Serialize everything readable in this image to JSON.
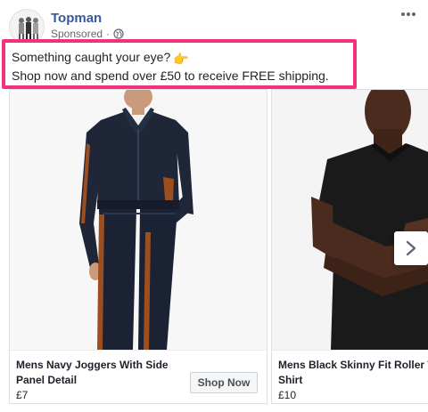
{
  "header": {
    "page_name": "Topman",
    "sponsored_label": "Sponsored",
    "separator": "·",
    "privacy_icon": "globe-icon",
    "more_icon": "more-dots-icon"
  },
  "caption": {
    "line1": "Something caught your eye?",
    "line1_emoji": "👉",
    "line2": "Shop now and spend over £50 to receive FREE shipping.",
    "highlight_color": "#f0337a"
  },
  "carousel": {
    "cards": [
      {
        "title": "Mens Navy Joggers With Side Panel Detail",
        "price": "£7",
        "cta": "Shop Now",
        "image": "navy-tracksuit-model-photo"
      },
      {
        "title": "Mens Black Skinny Fit Roller T Shirt",
        "price": "£10",
        "image": "black-tshirt-model-photo"
      }
    ],
    "next_icon": "chevron-right-icon"
  },
  "colors": {
    "page_name": "#385898",
    "text": "#1d2129",
    "meta": "#616770",
    "button_bg": "#f5f6f7"
  }
}
